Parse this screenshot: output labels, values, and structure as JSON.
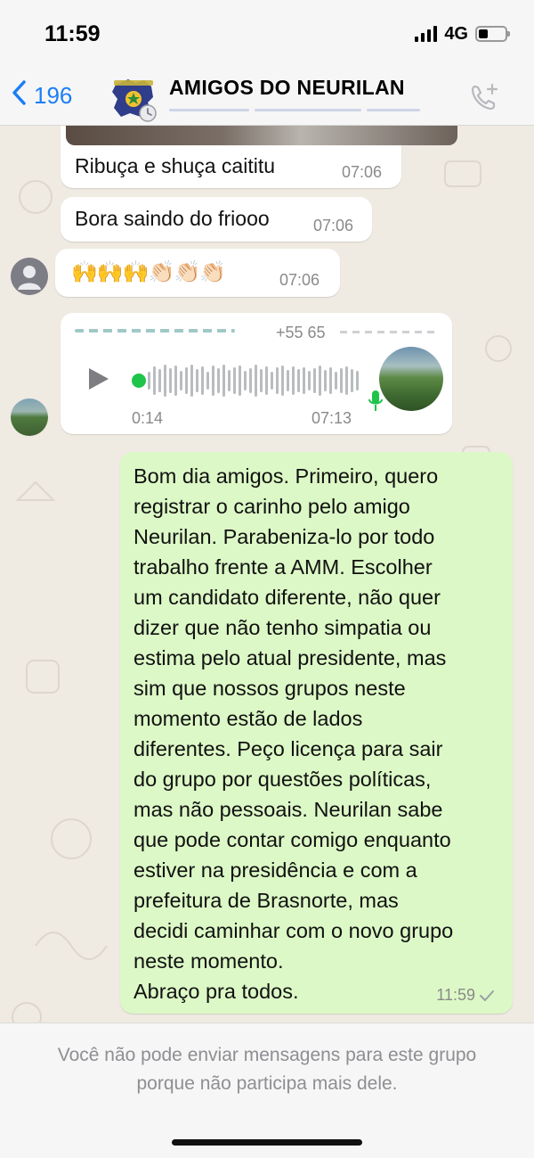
{
  "status_bar": {
    "time": "11:59",
    "network": "4G"
  },
  "header": {
    "back_count": "196",
    "group_name": "AMIGOS DO NEURILAN"
  },
  "messages": {
    "m1": {
      "text": "Ribuça e shuça caititu",
      "time": "07:06"
    },
    "m2": {
      "text": "Bora saindo do friooo",
      "time": "07:06"
    },
    "m3": {
      "text": "🙌🙌🙌👏🏻👏🏻👏🏻",
      "time": "07:06"
    },
    "voice": {
      "sender_phone": "+55 65",
      "duration": "0:14",
      "time": "07:13"
    },
    "sent": {
      "lines": [
        "Bom dia amigos. Primeiro, quero",
        "registrar o carinho pelo amigo",
        "Neurilan. Parabeniza-lo por todo",
        "trabalho frente a AMM. Escolher",
        "um candidato diferente, não quer",
        "dizer que não tenho simpatia ou",
        "estima pelo atual presidente, mas",
        "sim que nossos grupos neste",
        "momento estão de lados",
        "diferentes. Peço licença para sair",
        "do grupo por questões políticas,",
        "mas não pessoais. Neurilan sabe",
        "que pode contar comigo enquanto",
        "estiver na presidência e com a",
        "prefeitura de Brasnorte, mas",
        "decidi caminhar com o novo grupo",
        "neste momento.",
        "Abraço pra todos."
      ],
      "time": "11:59"
    }
  },
  "footer": {
    "line1": "Você não pode enviar mensagens para este grupo",
    "line2": "porque não participa mais dele."
  },
  "colors": {
    "accent": "#1b7ef6",
    "sent_bubble": "#dcf8c6",
    "received_bubble": "#ffffff",
    "online_dot": "#1fc44a"
  },
  "icons": [
    "back-chevron-icon",
    "add-call-icon",
    "play-icon",
    "mic-icon",
    "read-check-icon",
    "default-avatar-icon"
  ]
}
